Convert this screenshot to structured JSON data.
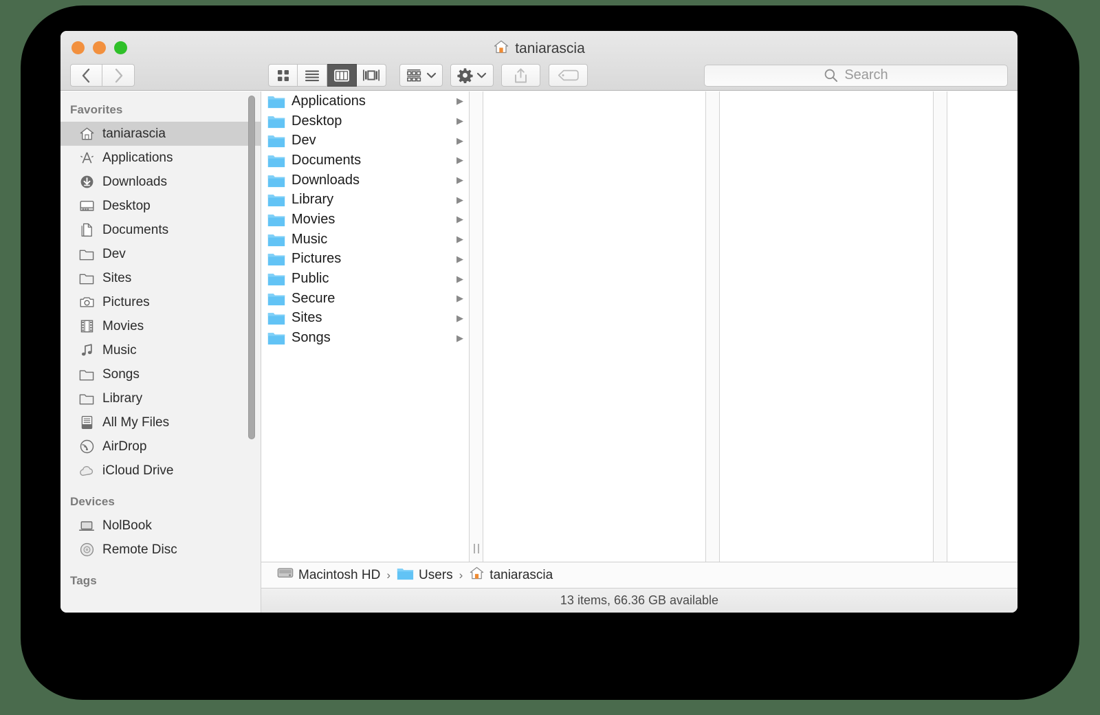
{
  "window": {
    "title": "taniarascia",
    "title_icon": "home-icon",
    "traffic_lights": [
      {
        "name": "close",
        "color": "#f2903e"
      },
      {
        "name": "minimize",
        "color": "#f2903e"
      },
      {
        "name": "maximize",
        "color": "#2fc029"
      }
    ]
  },
  "toolbar": {
    "back_label": "‹",
    "forward_label": "›",
    "view_modes": [
      {
        "name": "icon-view",
        "icon": "grid-icon",
        "active": false
      },
      {
        "name": "list-view",
        "icon": "list-icon",
        "active": false
      },
      {
        "name": "column-view",
        "icon": "columns-icon",
        "active": true
      },
      {
        "name": "coverflow-view",
        "icon": "coverflow-icon",
        "active": false
      }
    ],
    "arrange_label": "arrange-icon",
    "action_label": "gear-icon",
    "share_label": "share-icon",
    "tag_label": "tag-icon",
    "chevron": "⌄"
  },
  "search": {
    "placeholder": "Search",
    "value": "",
    "icon": "search-icon"
  },
  "sidebar": {
    "sections": [
      {
        "header": "Favorites",
        "items": [
          {
            "label": "taniarascia",
            "icon": "home-icon",
            "selected": true
          },
          {
            "label": "Applications",
            "icon": "applications-icon",
            "selected": false
          },
          {
            "label": "Downloads",
            "icon": "download-icon",
            "selected": false
          },
          {
            "label": "Desktop",
            "icon": "desktop-icon",
            "selected": false
          },
          {
            "label": "Documents",
            "icon": "documents-icon",
            "selected": false
          },
          {
            "label": "Dev",
            "icon": "folder-icon",
            "selected": false
          },
          {
            "label": "Sites",
            "icon": "folder-icon",
            "selected": false
          },
          {
            "label": "Pictures",
            "icon": "camera-icon",
            "selected": false
          },
          {
            "label": "Movies",
            "icon": "film-icon",
            "selected": false
          },
          {
            "label": "Music",
            "icon": "music-note-icon",
            "selected": false
          },
          {
            "label": "Songs",
            "icon": "folder-icon",
            "selected": false
          },
          {
            "label": "Library",
            "icon": "folder-icon",
            "selected": false
          },
          {
            "label": "All My Files",
            "icon": "all-my-files-icon",
            "selected": false
          },
          {
            "label": "AirDrop",
            "icon": "airdrop-icon",
            "selected": false
          },
          {
            "label": "iCloud Drive",
            "icon": "cloud-icon",
            "selected": false
          }
        ]
      },
      {
        "header": "Devices",
        "items": [
          {
            "label": "NolBook",
            "icon": "laptop-icon",
            "selected": false
          },
          {
            "label": "Remote Disc",
            "icon": "disc-icon",
            "selected": false
          }
        ]
      },
      {
        "header": "Tags",
        "items": []
      }
    ]
  },
  "columns": {
    "column1": {
      "items": [
        {
          "label": "Applications",
          "icon": "blue-folder-applications",
          "has_children": true
        },
        {
          "label": "Desktop",
          "icon": "blue-folder-desktop",
          "has_children": true
        },
        {
          "label": "Dev",
          "icon": "blue-folder",
          "has_children": true
        },
        {
          "label": "Documents",
          "icon": "blue-folder-documents",
          "has_children": true
        },
        {
          "label": "Downloads",
          "icon": "blue-folder-downloads",
          "has_children": true
        },
        {
          "label": "Library",
          "icon": "blue-folder-library",
          "has_children": true
        },
        {
          "label": "Movies",
          "icon": "blue-folder-movies",
          "has_children": true
        },
        {
          "label": "Music",
          "icon": "blue-folder-music",
          "has_children": true
        },
        {
          "label": "Pictures",
          "icon": "blue-folder-pictures",
          "has_children": true
        },
        {
          "label": "Public",
          "icon": "blue-folder-public",
          "has_children": true
        },
        {
          "label": "Secure",
          "icon": "blue-folder",
          "has_children": true
        },
        {
          "label": "Sites",
          "icon": "blue-folder-sites",
          "has_children": true
        },
        {
          "label": "Songs",
          "icon": "blue-folder",
          "has_children": true
        }
      ]
    },
    "column2": {
      "items": []
    },
    "column3": {
      "items": []
    },
    "column4": {
      "items": []
    },
    "chevron_glyph": "▶"
  },
  "pathbar": {
    "crumbs": [
      {
        "label": "Macintosh HD",
        "icon": "harddrive-icon"
      },
      {
        "label": "Users",
        "icon": "blue-folder"
      },
      {
        "label": "taniarascia",
        "icon": "home-icon"
      }
    ],
    "separator": "›"
  },
  "statusbar": {
    "text": "13 items, 66.36 GB available"
  }
}
